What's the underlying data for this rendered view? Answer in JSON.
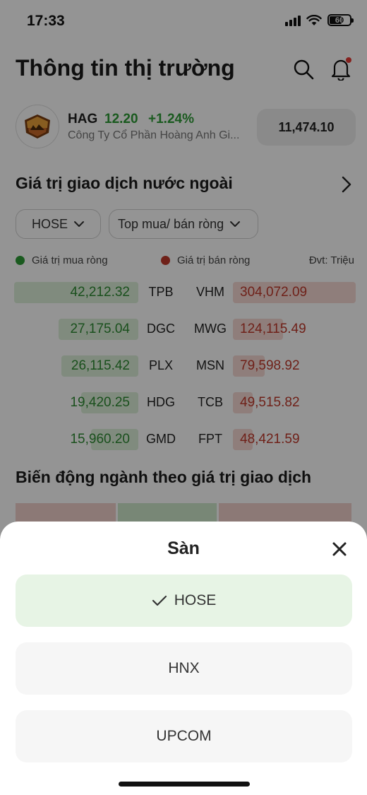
{
  "status_bar": {
    "time": "17:33",
    "battery": "60",
    "battery_level": 0.6
  },
  "header": {
    "title": "Thông tin thị trường",
    "notification_dot_color": "#e53935"
  },
  "stock": {
    "symbol": "HAG",
    "price": "12.20",
    "change": "+1.24%",
    "name": "Công Ty Cổ Phần Hoàng Anh Gi...",
    "index_value": "11,474.10"
  },
  "foreign_trade": {
    "title": "Giá trị giao dịch nước ngoài",
    "filters": {
      "exchange": "HOSE",
      "type": "Top mua/ bán ròng"
    },
    "legend": {
      "buy": "Giá trị mua ròng",
      "sell": "Giá trị bán ròng",
      "unit": "Đvt: Triệu"
    },
    "colors": {
      "buy": "#2e9b36",
      "sell": "#c0392b"
    },
    "rows": [
      {
        "buy_value": "42,212.32",
        "buy_symbol": "TPB",
        "sell_symbol": "VHM",
        "sell_value": "304,072.09",
        "buy_ratio": 1.0,
        "sell_ratio": 1.0
      },
      {
        "buy_value": "27,175.04",
        "buy_symbol": "DGC",
        "sell_symbol": "MWG",
        "sell_value": "124,115.49",
        "buy_ratio": 0.64,
        "sell_ratio": 0.41
      },
      {
        "buy_value": "26,115.42",
        "buy_symbol": "PLX",
        "sell_symbol": "MSN",
        "sell_value": "79,598.92",
        "buy_ratio": 0.62,
        "sell_ratio": 0.26
      },
      {
        "buy_value": "19,420.25",
        "buy_symbol": "HDG",
        "sell_symbol": "TCB",
        "sell_value": "49,515.82",
        "buy_ratio": 0.46,
        "sell_ratio": 0.16
      },
      {
        "buy_value": "15,960.20",
        "buy_symbol": "GMD",
        "sell_symbol": "FPT",
        "sell_value": "48,421.59",
        "buy_ratio": 0.38,
        "sell_ratio": 0.16
      }
    ]
  },
  "sector": {
    "title": "Biến động ngành theo giá trị giao dịch"
  },
  "sheet": {
    "title": "Sàn",
    "options": [
      {
        "label": "HOSE",
        "selected": true
      },
      {
        "label": "HNX",
        "selected": false
      },
      {
        "label": "UPCOM",
        "selected": false
      }
    ]
  }
}
